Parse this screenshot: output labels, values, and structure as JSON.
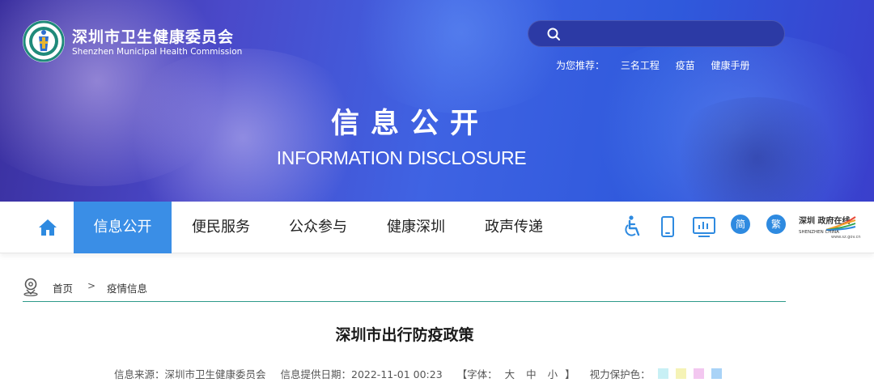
{
  "header": {
    "org_name_cn": "深圳市卫生健康委员会",
    "org_name_en": "Shenzhen Municipal Health Commission",
    "search": {
      "placeholder": "",
      "value": ""
    },
    "recommend": {
      "label": "为您推荐：",
      "links": [
        "三名工程",
        "疫苗",
        "健康手册"
      ]
    },
    "hero": {
      "title_cn": "信息公开",
      "title_en": "INFORMATION DISCLOSURE"
    }
  },
  "nav": {
    "items": [
      {
        "label": "信息公开",
        "active": true
      },
      {
        "label": "便民服务",
        "active": false
      },
      {
        "label": "公众参与",
        "active": false
      },
      {
        "label": "健康深圳",
        "active": false
      },
      {
        "label": "政声传递",
        "active": false
      }
    ],
    "tools": {
      "simplified": "简",
      "traditional": "繁"
    },
    "sz_logo": {
      "text_top": "深圳 政府在线",
      "text_mid": "SHENZHEN CHINA",
      "text_url": "www.sz.gov.cn"
    }
  },
  "breadcrumb": {
    "home": "首页",
    "separator": ">",
    "current": "疫情信息"
  },
  "article": {
    "title": "深圳市出行防疫政策",
    "source": "信息来源：深圳市卫生健康委员会",
    "date": "信息提供日期：2022-11-01 00:23",
    "font_label_open": "【字体：",
    "font_sizes": [
      "大",
      "中",
      "小"
    ],
    "font_label_close": "】",
    "eye_label": "视力保护色：",
    "eye_colors": [
      "#c8f0f5",
      "#f5f3b6",
      "#f3c7f0",
      "#a9d3f7"
    ]
  },
  "colors": {
    "nav_active": "#3a8ee6",
    "accent_blue": "#2e8ae0",
    "divider_teal": "#2e9a8a"
  }
}
